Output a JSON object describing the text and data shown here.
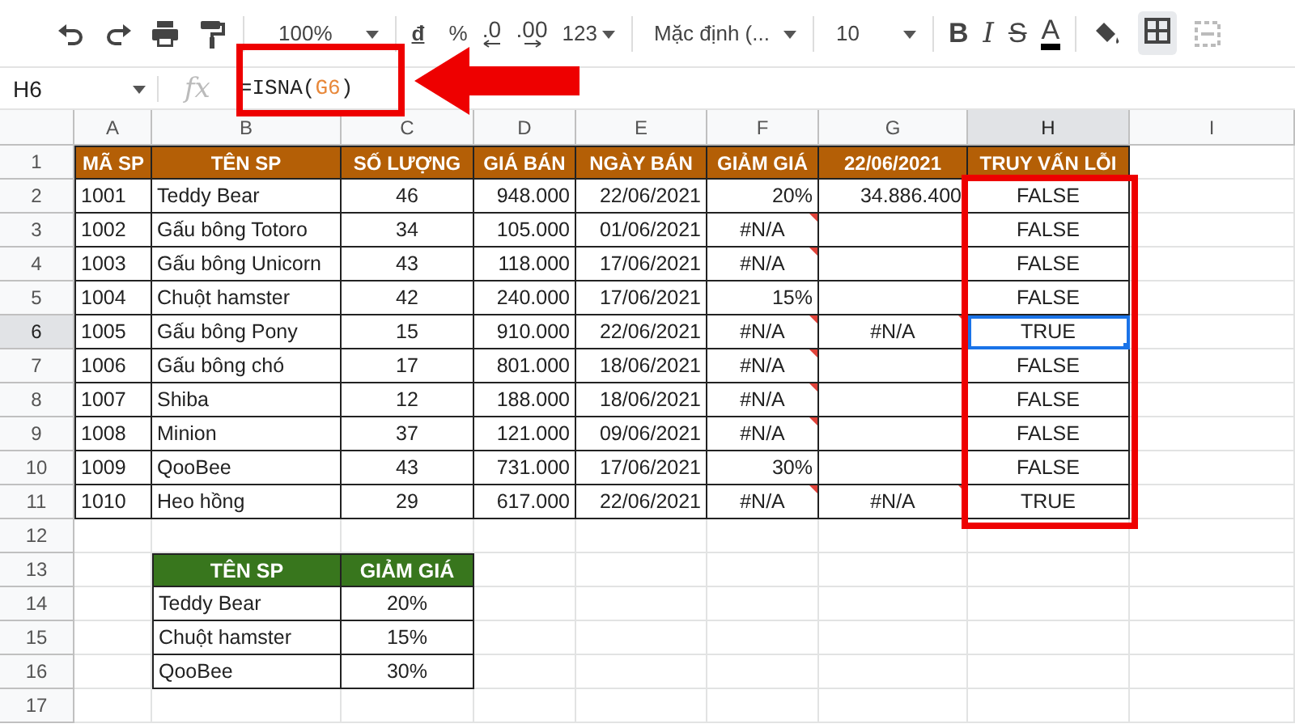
{
  "toolbar": {
    "zoom": "100%",
    "currency": "đ",
    "percent": "%",
    "decrease_decimals": ".0",
    "increase_decimals": ".00",
    "number_format": "123",
    "font": "Mặc định (...",
    "font_size": "10",
    "bold": "B",
    "italic": "I",
    "strikethrough": "S",
    "text_color": "A"
  },
  "formula_bar": {
    "name_box": "H6",
    "fx": "fx",
    "formula": [
      {
        "text": "=ISNA(",
        "kind": "plain"
      },
      {
        "text": "G6",
        "kind": "reference"
      },
      {
        "text": ")",
        "kind": "plain"
      }
    ]
  },
  "columns": [
    {
      "label": "A",
      "selected": false
    },
    {
      "label": "B",
      "selected": false
    },
    {
      "label": "C",
      "selected": false
    },
    {
      "label": "D",
      "selected": false
    },
    {
      "label": "E",
      "selected": false
    },
    {
      "label": "F",
      "selected": false
    },
    {
      "label": "G",
      "selected": false
    },
    {
      "label": "H",
      "selected": true
    },
    {
      "label": "I",
      "selected": false
    }
  ],
  "row_labels": [
    "1",
    "2",
    "3",
    "4",
    "5",
    "6",
    "7",
    "8",
    "9",
    "10",
    "11",
    "12",
    "13",
    "14",
    "15",
    "16",
    "17"
  ],
  "main_table": {
    "header": [
      "MÃ SP",
      "TÊN SP",
      "SỐ LƯỢNG",
      "GIÁ BÁN",
      "NGÀY BÁN",
      "GIẢM GIÁ",
      "22/06/2021",
      "TRUY VẤN LỖI"
    ],
    "rows": [
      {
        "cells": [
          "1001",
          "Teddy Bear",
          "46",
          "948.000",
          "22/06/2021",
          "20%",
          "34.886.400",
          "FALSE"
        ],
        "flagged": [
          false,
          false,
          false,
          false,
          false,
          false,
          false,
          false
        ],
        "selected": false
      },
      {
        "cells": [
          "1002",
          "Gấu bông Totoro",
          "34",
          "105.000",
          "01/06/2021",
          "#N/A",
          "",
          "FALSE"
        ],
        "flagged": [
          false,
          false,
          false,
          false,
          false,
          true,
          false,
          false
        ],
        "selected": false
      },
      {
        "cells": [
          "1003",
          "Gấu bông Unicorn",
          "43",
          "118.000",
          "17/06/2021",
          "#N/A",
          "",
          "FALSE"
        ],
        "flagged": [
          false,
          false,
          false,
          false,
          false,
          true,
          false,
          false
        ],
        "selected": false
      },
      {
        "cells": [
          "1004",
          "Chuột hamster",
          "42",
          "240.000",
          "17/06/2021",
          "15%",
          "",
          "FALSE"
        ],
        "flagged": [
          false,
          false,
          false,
          false,
          false,
          false,
          false,
          false
        ],
        "selected": false
      },
      {
        "cells": [
          "1005",
          "Gấu bông Pony",
          "15",
          "910.000",
          "22/06/2021",
          "#N/A",
          "#N/A",
          "TRUE"
        ],
        "flagged": [
          false,
          false,
          false,
          false,
          false,
          true,
          true,
          false
        ],
        "selected": true
      },
      {
        "cells": [
          "1006",
          "Gấu bông chó",
          "17",
          "801.000",
          "18/06/2021",
          "#N/A",
          "",
          "FALSE"
        ],
        "flagged": [
          false,
          false,
          false,
          false,
          false,
          true,
          false,
          false
        ],
        "selected": false
      },
      {
        "cells": [
          "1007",
          "Shiba",
          "12",
          "188.000",
          "18/06/2021",
          "#N/A",
          "",
          "FALSE"
        ],
        "flagged": [
          false,
          false,
          false,
          false,
          false,
          true,
          false,
          false
        ],
        "selected": false
      },
      {
        "cells": [
          "1008",
          "Minion",
          "37",
          "121.000",
          "09/06/2021",
          "#N/A",
          "",
          "FALSE"
        ],
        "flagged": [
          false,
          false,
          false,
          false,
          false,
          true,
          false,
          false
        ],
        "selected": false
      },
      {
        "cells": [
          "1009",
          "QooBee",
          "43",
          "731.000",
          "17/06/2021",
          "30%",
          "",
          "FALSE"
        ],
        "flagged": [
          false,
          false,
          false,
          false,
          false,
          false,
          false,
          false
        ],
        "selected": false
      },
      {
        "cells": [
          "1010",
          "Heo hồng",
          "29",
          "617.000",
          "22/06/2021",
          "#N/A",
          "#N/A",
          "TRUE"
        ],
        "flagged": [
          false,
          false,
          false,
          false,
          false,
          true,
          true,
          false
        ],
        "selected": false
      }
    ]
  },
  "discount_table": {
    "header": [
      "TÊN SP",
      "GIẢM GIÁ"
    ],
    "rows": [
      [
        "Teddy Bear",
        "20%"
      ],
      [
        "Chuột hamster",
        "15%"
      ],
      [
        "QooBee",
        "30%"
      ]
    ]
  }
}
